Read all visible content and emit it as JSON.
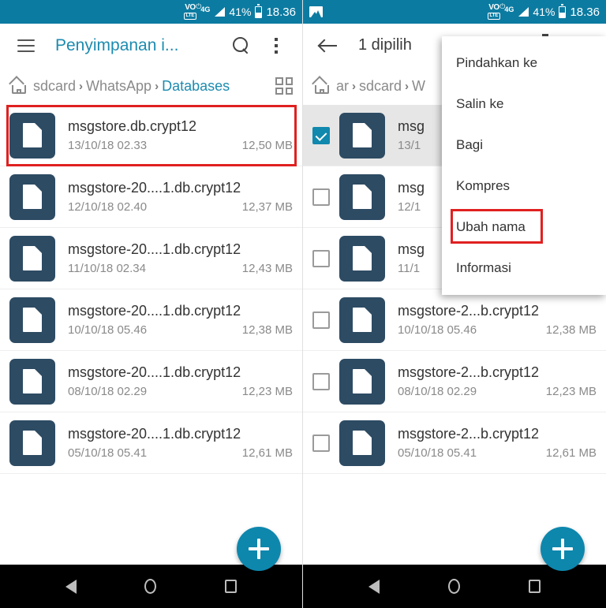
{
  "status_bar": {
    "photo_icon": "photo-icon",
    "volte_label": "VO",
    "lte_label": "LTE",
    "network": "4G",
    "battery_percent": "41%",
    "clock": "18.36"
  },
  "left_panel": {
    "app_bar": {
      "menu_icon": "hamburger-icon",
      "title": "Penyimpanan i...",
      "search_icon": "search-icon",
      "overflow_icon": "overflow-menu-icon"
    },
    "breadcrumb": {
      "home_icon": "home-icon",
      "crumbs": [
        {
          "label": "sdcard",
          "active": false
        },
        {
          "label": "WhatsApp",
          "active": false
        },
        {
          "label": "Databases",
          "active": true
        }
      ],
      "separator": "›",
      "grid_view_icon": "grid-view-icon"
    },
    "files": [
      {
        "name": "msgstore.db.crypt12",
        "date": "13/10/18 02.33",
        "size": "12,50 MB",
        "highlighted": true
      },
      {
        "name": "msgstore-20....1.db.crypt12",
        "date": "12/10/18 02.40",
        "size": "12,37 MB",
        "highlighted": false
      },
      {
        "name": "msgstore-20....1.db.crypt12",
        "date": "11/10/18 02.34",
        "size": "12,43 MB",
        "highlighted": false
      },
      {
        "name": "msgstore-20....1.db.crypt12",
        "date": "10/10/18 05.46",
        "size": "12,38 MB",
        "highlighted": false
      },
      {
        "name": "msgstore-20....1.db.crypt12",
        "date": "08/10/18 02.29",
        "size": "12,23 MB",
        "highlighted": false
      },
      {
        "name": "msgstore-20....1.db.crypt12",
        "date": "05/10/18 05.41",
        "size": "12,61 MB",
        "highlighted": false
      }
    ],
    "fab_label": "+",
    "nav_bar": {
      "back": "back-triangle",
      "home": "home-circle",
      "recents": "recents-square"
    }
  },
  "right_panel": {
    "app_bar": {
      "back_icon": "back-arrow-icon",
      "title": "1 dipilih",
      "select_all_icon": "select-all-icon",
      "delete_icon": "trash-icon",
      "overflow_icon": "overflow-menu-icon"
    },
    "breadcrumb": {
      "home_icon": "home-icon",
      "crumbs": [
        {
          "label": "ar",
          "active": false
        },
        {
          "label": "sdcard",
          "active": false
        },
        {
          "label": "W",
          "active": false
        }
      ],
      "separator": "›"
    },
    "overflow_menu": {
      "items": [
        {
          "label": "Pindahkan ke",
          "highlighted": false
        },
        {
          "label": "Salin ke",
          "highlighted": false
        },
        {
          "label": "Bagi",
          "highlighted": false
        },
        {
          "label": "Kompres",
          "highlighted": false
        },
        {
          "label": "Ubah nama",
          "highlighted": true
        },
        {
          "label": "Informasi",
          "highlighted": false
        }
      ]
    },
    "files": [
      {
        "name": "msg",
        "date": "13/1",
        "size": "",
        "checked": true
      },
      {
        "name": "msg",
        "date": "12/1",
        "size": "",
        "checked": false
      },
      {
        "name": "msg",
        "date": "11/1",
        "size": "",
        "checked": false
      },
      {
        "name": "msgstore-2...b.crypt12",
        "date": "10/10/18 05.46",
        "size": "12,38 MB",
        "checked": false
      },
      {
        "name": "msgstore-2...b.crypt12",
        "date": "08/10/18 02.29",
        "size": "12,23 MB",
        "checked": false
      },
      {
        "name": "msgstore-2...b.crypt12",
        "date": "05/10/18 05.41",
        "size": "12,61 MB",
        "checked": false
      }
    ],
    "fab_label": "+",
    "nav_bar": {
      "back": "back-triangle",
      "home": "home-circle",
      "recents": "recents-square"
    }
  },
  "colors": {
    "teal": "#0c7ba1",
    "teal_accent": "#1c8bb0",
    "file_icon": "#2d4b63",
    "highlight_red": "#e02020",
    "checkbox_checked": "#1188ad"
  }
}
